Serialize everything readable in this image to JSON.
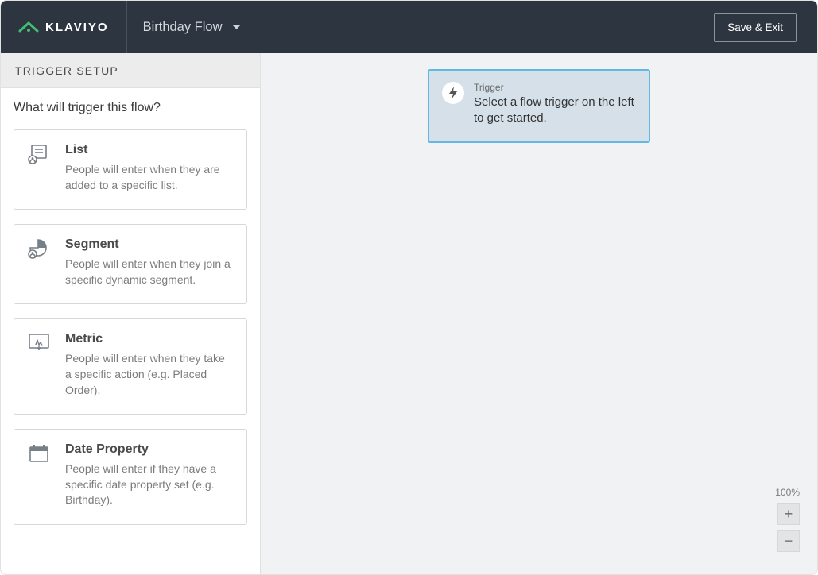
{
  "header": {
    "brand": "KLAVIYO",
    "flow_name": "Birthday Flow",
    "save_exit": "Save & Exit"
  },
  "sidebar": {
    "panel_title": "TRIGGER SETUP",
    "prompt": "What will trigger this flow?",
    "options": [
      {
        "icon": "list-icon",
        "title": "List",
        "desc": "People will enter when they are added to a specific list."
      },
      {
        "icon": "segment-icon",
        "title": "Segment",
        "desc": "People will enter when they join a specific dynamic segment."
      },
      {
        "icon": "metric-icon",
        "title": "Metric",
        "desc": "People will enter when they take a specific action (e.g. Placed Order)."
      },
      {
        "icon": "date-property-icon",
        "title": "Date Property",
        "desc": "People will enter if they have a specific date property set (e.g. Birthday)."
      }
    ]
  },
  "canvas": {
    "trigger_label": "Trigger",
    "trigger_text": "Select a flow trigger on the left to get started.",
    "zoom_level": "100%"
  }
}
